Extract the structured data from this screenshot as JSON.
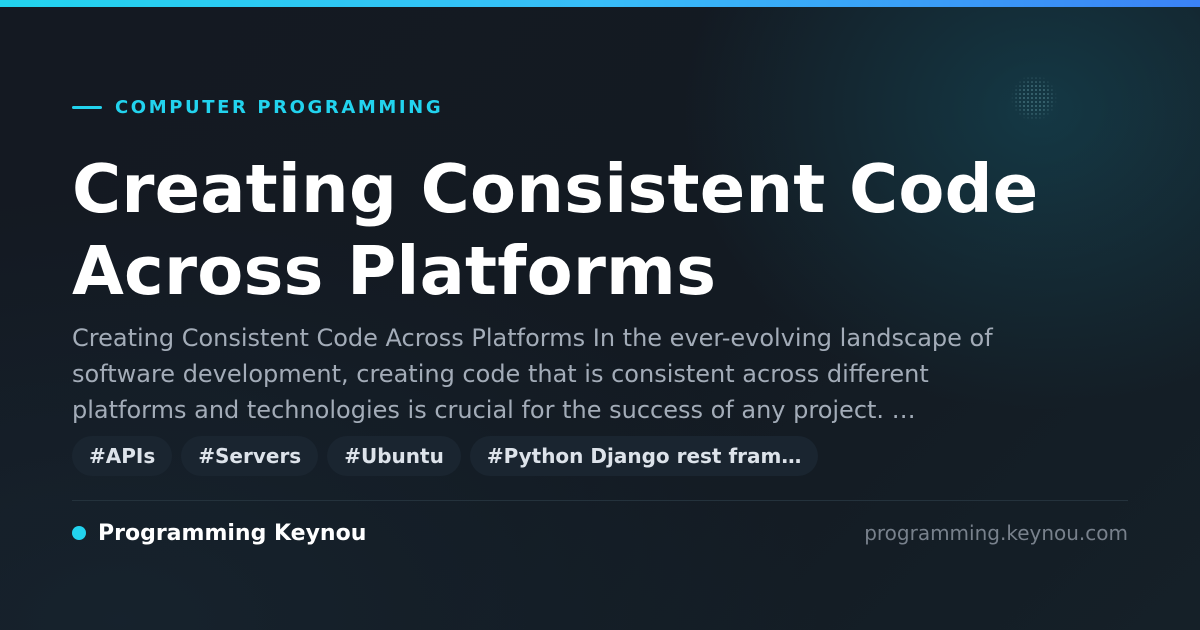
{
  "category": "COMPUTER PROGRAMMING",
  "title_lines": [
    "Creating Consistent Code",
    "Across Platforms"
  ],
  "excerpt_lines": [
    "Creating Consistent Code Across Platforms In the ever-evolving landscape of",
    "software development, creating code that is consistent across different",
    "platforms and technologies is crucial for the success of any project. …"
  ],
  "tags": [
    "#APIs",
    "#Servers",
    "#Ubuntu",
    "#Python Django rest fram…"
  ],
  "footer": {
    "brand": "Programming Keynou",
    "domain": "programming.keynou.com"
  },
  "colors": {
    "accent": "#22d3ee",
    "background": "#141a22",
    "title": "#ffffff",
    "excerpt": "#a3acb8",
    "tag_background": "#1a2530"
  }
}
